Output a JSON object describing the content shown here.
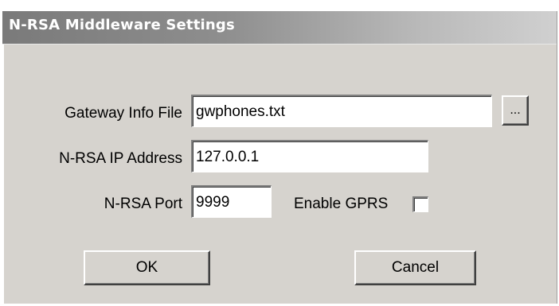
{
  "dialog": {
    "title": "N-RSA Middleware Settings"
  },
  "fields": {
    "gateway_info_file": {
      "label": "Gateway Info File",
      "value": "gwphones.txt"
    },
    "browse_button_label": "...",
    "ip_address": {
      "label": "N-RSA IP Address",
      "value": "127.0.0.1"
    },
    "port": {
      "label": "N-RSA Port",
      "value": "9999"
    },
    "enable_gprs": {
      "label": "Enable GPRS",
      "checked": false
    }
  },
  "buttons": {
    "ok_label": "OK",
    "cancel_label": "Cancel"
  },
  "colors": {
    "dialog_face": "#d6d3ce",
    "title_text": "#ffffff"
  }
}
